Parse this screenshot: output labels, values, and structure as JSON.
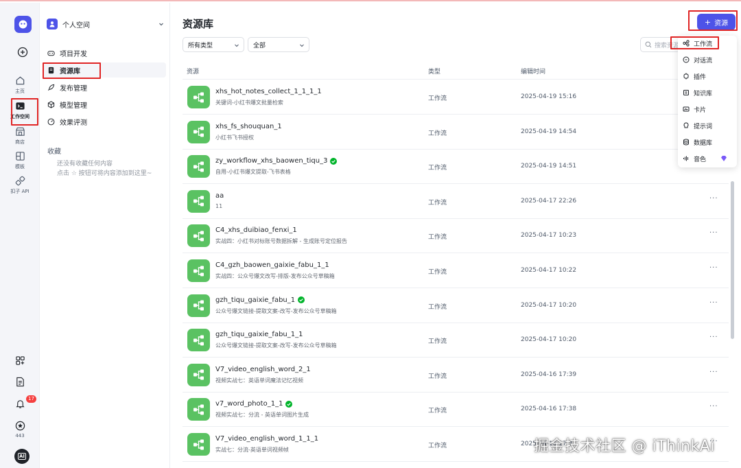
{
  "rail": {
    "items": [
      {
        "label": "主页"
      },
      {
        "label": "工作空间"
      },
      {
        "label": "商店"
      },
      {
        "label": "模板"
      },
      {
        "label": "扣子 API"
      }
    ],
    "notification_count": "17",
    "points": "443",
    "avatar_text": "AI"
  },
  "sidebar": {
    "space_name": "个人空间",
    "nav": [
      {
        "label": "项目开发"
      },
      {
        "label": "资源库"
      },
      {
        "label": "发布管理"
      },
      {
        "label": "模型管理"
      },
      {
        "label": "效果评测"
      }
    ],
    "favorites_title": "收藏",
    "favorites_empty_line1": "还没有收藏任何内容",
    "favorites_empty_line2": "点击 ☆ 按钮可将内容添加到这里~"
  },
  "main": {
    "title": "资源库",
    "add_button": "资源",
    "filter_type": "所有类型",
    "filter_scope": "全部",
    "search_placeholder": "搜索资源",
    "columns": [
      "资源",
      "类型",
      "编辑时间"
    ],
    "rows": [
      {
        "name": "xhs_hot_notes_collect_1_1_1_1",
        "desc": "关键词-小红书爆文批量检索",
        "type": "工作流",
        "time": "2025-04-19 15:16",
        "verified": false
      },
      {
        "name": "xhs_fs_shouquan_1",
        "desc": "小红书飞书授权",
        "type": "工作流",
        "time": "2025-04-19 14:54",
        "verified": false
      },
      {
        "name": "zy_workflow_xhs_baowen_tiqu_3",
        "desc": "自用-小红书爆文提取-飞书表格",
        "type": "工作流",
        "time": "2025-04-19 14:51",
        "verified": true
      },
      {
        "name": "aa",
        "desc": "11",
        "type": "工作流",
        "time": "2025-04-17 22:26",
        "verified": false
      },
      {
        "name": "C4_xhs_duibiao_fenxi_1",
        "desc": "实战四：小红书对标账号数据拆解 - 生成账号定位报告",
        "type": "工作流",
        "time": "2025-04-17 10:23",
        "verified": false
      },
      {
        "name": "C4_gzh_baowen_gaixie_fabu_1_1",
        "desc": "实战四：公众号爆文改写-排版-发布公众号草稿箱",
        "type": "工作流",
        "time": "2025-04-17 10:22",
        "verified": false
      },
      {
        "name": "gzh_tiqu_gaixie_fabu_1",
        "desc": "公众号爆文链接-提取文案-改写-发布公众号草稿箱",
        "type": "工作流",
        "time": "2025-04-17 10:20",
        "verified": true
      },
      {
        "name": "gzh_tiqu_gaixie_fabu_1_1",
        "desc": "公众号爆文链接-提取文案-改写-发布公众号草稿箱",
        "type": "工作流",
        "time": "2025-04-17 10:20",
        "verified": false
      },
      {
        "name": "V7_video_english_word_2_1",
        "desc": "视频实战七：英语单词魔法记忆视频",
        "type": "工作流",
        "time": "2025-04-16 17:39",
        "verified": false
      },
      {
        "name": "v7_word_photo_1_1",
        "desc": "视频实战七：分流 - 英语单词图片生成",
        "type": "工作流",
        "time": "2025-04-16 17:38",
        "verified": true
      },
      {
        "name": "V7_video_english_word_1_1_1",
        "desc": "实战七：分流-英语单词视频帧",
        "type": "工作流",
        "time": "2025-04-16 17:3",
        "verified": false
      }
    ],
    "more_label": "···"
  },
  "menu": {
    "items": [
      {
        "label": "工作流",
        "icon": "workflow-icon"
      },
      {
        "label": "对话流",
        "icon": "chatflow-icon"
      },
      {
        "label": "插件",
        "icon": "plugin-icon"
      },
      {
        "label": "知识库",
        "icon": "knowledge-icon"
      },
      {
        "label": "卡片",
        "icon": "card-icon"
      },
      {
        "label": "提示词",
        "icon": "prompt-icon"
      },
      {
        "label": "数据库",
        "icon": "database-icon"
      },
      {
        "label": "音色",
        "icon": "voice-icon"
      }
    ]
  },
  "watermark": "掘金技术社区 @ iThinkAi",
  "colors": {
    "accent": "#4d53e8",
    "workflow_green": "#5ac262",
    "highlight_red": "#e02424",
    "verified_green": "#00b42a"
  }
}
